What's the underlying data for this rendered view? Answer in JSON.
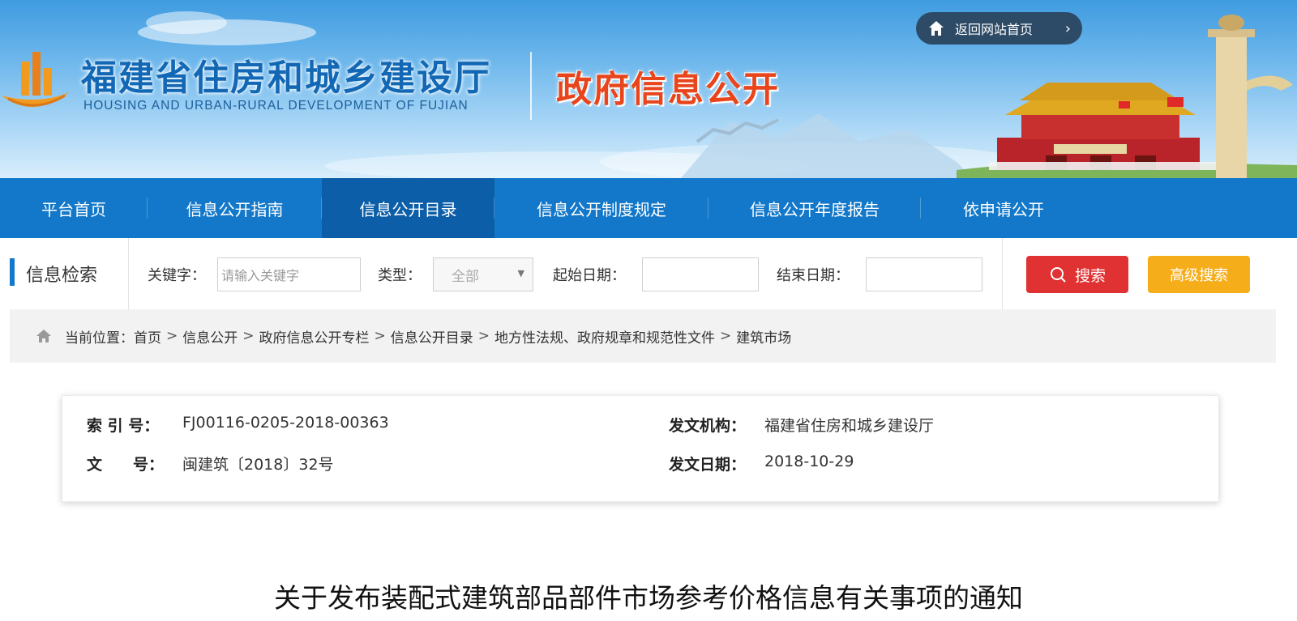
{
  "colors": {
    "nav_bg": "#1378c9",
    "nav_active": "#0b5ea7",
    "title_blue": "#1268b5",
    "title_red": "#e8451c",
    "search_btn": "#e03133",
    "advanced_btn": "#f6ad1a"
  },
  "header": {
    "cn_title": "福建省住房和城乡建设厅",
    "en_title": "HOUSING AND URBAN-RURAL DEVELOPMENT OF FUJIAN",
    "portal_title": "政府信息公开",
    "back_home": {
      "label": "返回网站首页",
      "icon": "home-icon",
      "chevron": "›"
    }
  },
  "nav": {
    "items": [
      {
        "label": "平台首页"
      },
      {
        "label": "信息公开指南"
      },
      {
        "label": "信息公开目录",
        "active": true
      },
      {
        "label": "信息公开制度规定"
      },
      {
        "label": "信息公开年度报告"
      },
      {
        "label": "依申请公开"
      }
    ]
  },
  "search": {
    "title": "信息检索",
    "keyword_label": "关键字：",
    "keyword_placeholder": "请输入关键字",
    "type_label": "类型：",
    "type_value": "全部",
    "start_label": "起始日期：",
    "end_label": "结束日期：",
    "search_button": "搜索",
    "advanced_button": "高级搜索"
  },
  "breadcrumb": {
    "prefix": "当前位置：",
    "items": [
      "首页",
      "信息公开",
      "政府信息公开专栏",
      "信息公开目录",
      "地方性法规、政府规章和规范性文件",
      "建筑市场"
    ],
    "separator": ">"
  },
  "meta": {
    "index_label": "索 引 号：",
    "index_value": "FJ00116-0205-2018-00363",
    "doc_no_label": "文　　号：",
    "doc_no_value": "闽建筑〔2018〕32号",
    "issuer_label": "发文机构：",
    "issuer_value": "福建省住房和城乡建设厅",
    "date_label": "发文日期：",
    "date_value": "2018-10-29"
  },
  "article": {
    "title": "关于发布装配式建筑部品部件市场参考价格信息有关事项的通知"
  }
}
